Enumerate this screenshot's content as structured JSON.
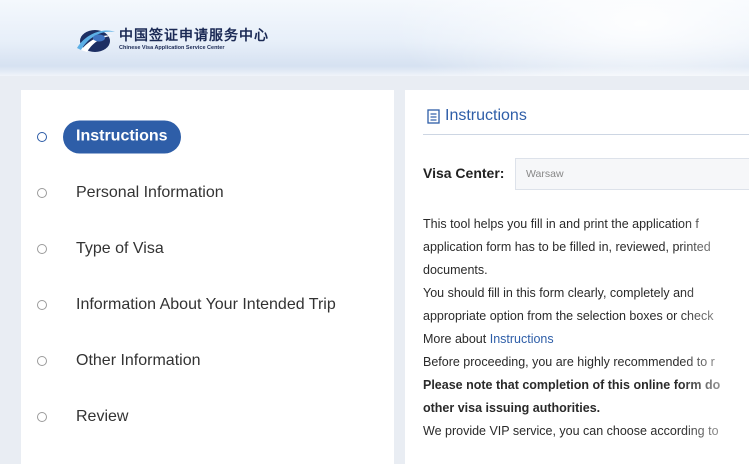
{
  "header": {
    "logo_cn": "中国签证申请服务中心",
    "logo_en": "Chinese Visa Application Service Center",
    "logo_icon": "swoosh-logo-icon"
  },
  "steps": [
    {
      "label": "Instructions",
      "active": true
    },
    {
      "label": "Personal Information",
      "active": false
    },
    {
      "label": "Type of Visa",
      "active": false
    },
    {
      "label": "Information About Your Intended Trip",
      "active": false
    },
    {
      "label": "Other Information",
      "active": false
    },
    {
      "label": "Review",
      "active": false
    }
  ],
  "content": {
    "title": "Instructions",
    "title_icon": "document-icon",
    "visa_center_label": "Visa Center:",
    "visa_center_value": "Warsaw",
    "lines": [
      "This tool helps you fill in and print the application f",
      "application form has to be filled in, reviewed, printed",
      "documents.",
      "You should fill in this form clearly, completely and",
      "appropriate option from the selection boxes or check",
      "Before proceeding, you are highly recommended to r",
      "other visa issuing authorities.",
      "We provide VIP service, you can choose according to"
    ],
    "more_about_prefix": "More about ",
    "more_about_link": "Instructions",
    "note_bold": "Please note that completion of this online form do",
    "note_rest": "e"
  },
  "colors": {
    "accent": "#2e5ea8",
    "page_bg": "#e9edf3"
  }
}
